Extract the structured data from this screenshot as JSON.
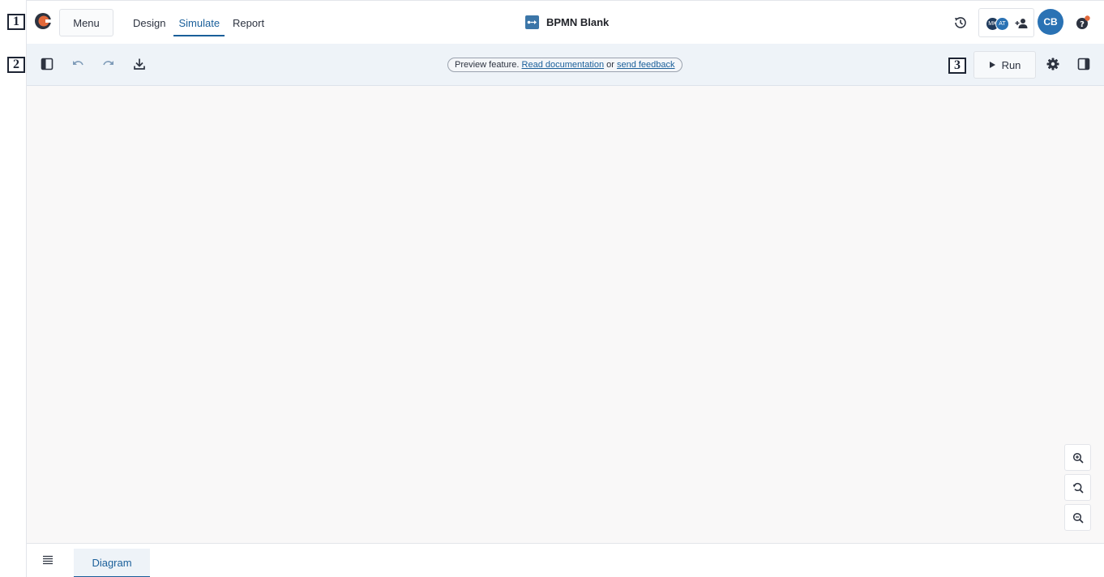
{
  "steps": [
    "1",
    "2",
    "3"
  ],
  "topbar": {
    "menu_label": "Menu",
    "tabs": [
      {
        "label": "Design",
        "active": false
      },
      {
        "label": "Simulate",
        "active": true
      },
      {
        "label": "Report",
        "active": false
      }
    ],
    "document_title": "BPMN Blank",
    "collaborators": [
      "MK",
      "AT"
    ],
    "user_initials": "CB"
  },
  "toolbar": {
    "preview_text": "Preview feature.",
    "read_doc_link": "Read documentation",
    "or_text": "or",
    "feedback_link": "send feedback",
    "run_label": "Run"
  },
  "bottombar": {
    "diagram_tab": "Diagram"
  },
  "icons": {
    "logo": "camunda-logo-icon",
    "history": "history-icon",
    "add_user": "add-user-icon",
    "help": "help-icon",
    "panel_left": "panel-left-icon",
    "undo": "undo-icon",
    "redo": "redo-icon",
    "download": "download-icon",
    "play": "play-icon",
    "settings": "gear-icon",
    "panel_right": "panel-right-icon",
    "zoom_in": "zoom-in-icon",
    "zoom_reset": "zoom-reset-icon",
    "zoom_out": "zoom-out-icon",
    "list": "list-icon"
  },
  "colors": {
    "accent": "#1a5f9a",
    "logo_orange": "#e2693b",
    "avatar_blue": "#2a72b4",
    "notification": "#e2693b"
  }
}
